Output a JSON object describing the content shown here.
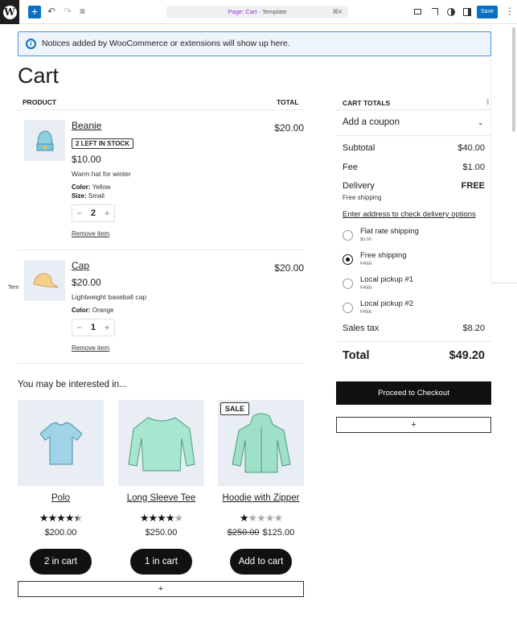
{
  "toolbar": {
    "add": "+",
    "undo": "↶",
    "redo": "↷",
    "list": "≡",
    "page_label": "Page: Cart",
    "separator": " · ",
    "template_label": "Template",
    "shortcut": "⌘K",
    "save_label": "Save",
    "more": "⋮"
  },
  "notice": {
    "icon": "i",
    "text": "Notices added by WooCommerce or extensions will show up here."
  },
  "page_title": "Cart",
  "side_label": "Tem",
  "cart": {
    "col_product": "PRODUCT",
    "col_total": "TOTAL",
    "items": [
      {
        "name": "Beanie",
        "badge": "2 LEFT IN STOCK",
        "price": "$10.00",
        "description": "Warm hat for winter",
        "color_label": "Color:",
        "color": " Yellow",
        "size_label": "Size:",
        "size": " Small",
        "qty": "2",
        "remove": "Remove item",
        "total": "$20.00"
      },
      {
        "name": "Cap",
        "price": "$20.00",
        "description": "Lightweight baseball cap",
        "color_label": "Color:",
        "color": " Orange",
        "qty": "1",
        "remove": "Remove item",
        "total": "$20.00"
      }
    ],
    "qty_minus": "−",
    "qty_plus": "+"
  },
  "cross_sells": {
    "title": "You may be interested in...",
    "products": [
      {
        "name": "Polo",
        "rating": 4.5,
        "price": "$200.00",
        "button": "2 in cart"
      },
      {
        "name": "Long Sleeve Tee",
        "rating": 4,
        "price": "$250.00",
        "button": "1 in cart"
      },
      {
        "name": "Hoodie with Zipper",
        "rating": 1,
        "sale_badge": "SALE",
        "old_price": "$250.00",
        "price": "$125.00",
        "button": "Add to cart"
      }
    ],
    "add_block": "+"
  },
  "totals": {
    "title": "CART TOTALS",
    "coupon": "Add a coupon",
    "subtotal_label": "Subtotal",
    "subtotal": "$40.00",
    "fee_label": "Fee",
    "fee": "$1.00",
    "delivery_label": "Delivery",
    "delivery": "FREE",
    "delivery_sub": "Free shipping",
    "address_link": "Enter address to check delivery options",
    "shipping": [
      {
        "label": "Flat rate shipping",
        "sub": "$5.00",
        "selected": false
      },
      {
        "label": "Free shipping",
        "sub": "FREE",
        "selected": true
      },
      {
        "label": "Local pickup #1",
        "sub": "FREE",
        "selected": false
      },
      {
        "label": "Local pickup #2",
        "sub": "FREE",
        "selected": false
      }
    ],
    "tax_label": "Sales tax",
    "tax": "$8.20",
    "total_label": "Total",
    "total": "$49.20",
    "checkout": "Proceed to Checkout",
    "add_block": "+"
  }
}
